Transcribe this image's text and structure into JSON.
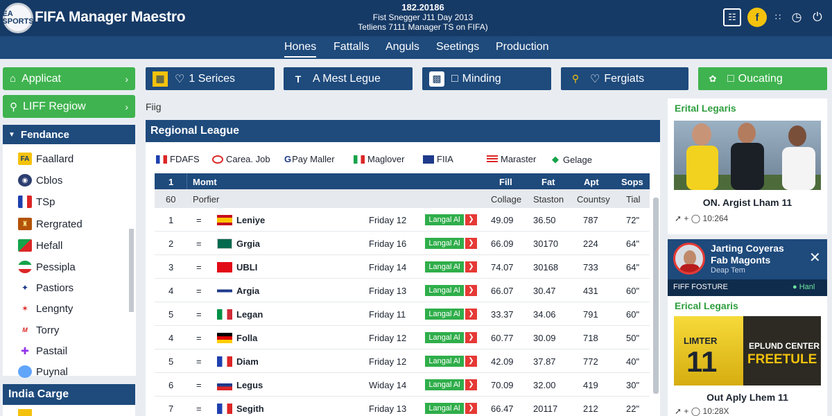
{
  "app": {
    "logo_text": "EA SPORTS",
    "title": "FIFA Manager Maestro"
  },
  "header_info": {
    "line1": "182.20186",
    "line2": "Fist Snegger J11 Day 2013",
    "line3": "Tetliens 7111 Manager TS on FIFA)"
  },
  "nav": {
    "items": [
      "Hones",
      "Fattalls",
      "Anguls",
      "Seetings",
      "Production"
    ]
  },
  "left": {
    "btn1": "Applicat",
    "btn2": "LIFF Regiow",
    "panel_title": "Fendance",
    "items": [
      "Faallard",
      "Cblos",
      "TSp",
      "Rergrated",
      "Hefall",
      "Pessipla",
      "Pastiors",
      "Lengnty",
      "Torry",
      "Pastail",
      "Puynal"
    ],
    "bottom_title": "India Carge"
  },
  "top_buttons": [
    "1 Serices",
    "A Mest Legue",
    "Minding",
    "Fergiats",
    "Oucating"
  ],
  "breadcrumb": "Fiig",
  "league": {
    "title": "Regional League",
    "filters": [
      "FDAFS",
      "Carea. Job",
      "Pay Maller",
      "Maglover",
      "FIIA",
      "Maraster",
      "Gelage"
    ],
    "header": {
      "rank": "1",
      "team": "Momt",
      "c1": "Fill",
      "c2": "Fat",
      "c3": "Apt",
      "c4": "Sops"
    },
    "subheader": {
      "rank": "60",
      "team": "Porfier",
      "c1": "Collage",
      "c2": "Staston",
      "c3": "Countsy",
      "c4": "Tial"
    },
    "badge_label": "Langal Al",
    "rows": [
      {
        "rank": "1",
        "team": "Leniye",
        "date": "Friday 12",
        "v1": "49.09",
        "v2": "36.50",
        "v3": "787",
        "v4": "72\""
      },
      {
        "rank": "2",
        "team": "Grgia",
        "date": "Friday 16",
        "v1": "66.09",
        "v2": "30170",
        "v3": "224",
        "v4": "64\""
      },
      {
        "rank": "3",
        "team": "UBLI",
        "date": "Friday 14",
        "v1": "74.07",
        "v2": "30168",
        "v3": "733",
        "v4": "64\""
      },
      {
        "rank": "4",
        "team": "Argia",
        "date": "Friday 13",
        "v1": "66.07",
        "v2": "30.47",
        "v3": "431",
        "v4": "60\""
      },
      {
        "rank": "5",
        "team": "Legan",
        "date": "Friday 11",
        "v1": "33.37",
        "v2": "34.06",
        "v3": "791",
        "v4": "60\""
      },
      {
        "rank": "4",
        "team": "Folla",
        "date": "Friday 12",
        "v1": "60.77",
        "v2": "30.09",
        "v3": "718",
        "v4": "50\""
      },
      {
        "rank": "5",
        "team": "Diam",
        "date": "Friday 12",
        "v1": "42.09",
        "v2": "37.87",
        "v3": "772",
        "v4": "40\""
      },
      {
        "rank": "6",
        "team": "Legus",
        "date": "Widay 14",
        "v1": "70.09",
        "v2": "32.00",
        "v3": "419",
        "v4": "30\""
      },
      {
        "rank": "7",
        "team": "Segith",
        "date": "Friday 13",
        "v1": "66.47",
        "v2": "20117",
        "v3": "212",
        "v4": "22\""
      }
    ]
  },
  "right": {
    "card1": {
      "title": "Erital Legaris",
      "caption": "ON. Argist Lham 11",
      "meta": "10:264"
    },
    "notif": {
      "line1": "Jarting Coyeras",
      "line2": "Fab Magonts",
      "line3": "Deap Tem",
      "footer": "FIFF FOSTURE",
      "status": "Hanl"
    },
    "card2": {
      "title": "Erical Legaris",
      "caption": "Out Aply Lhem 11",
      "meta": "10:28X",
      "promo1": "EPLUND CENTER",
      "promo2": "FREETULE",
      "shirt_name": "LIMTER",
      "shirt_num": "11"
    }
  },
  "colors": {
    "primary": "#1e4a7c",
    "topbar": "#163a66",
    "accent_green": "#3fb34f",
    "alert_red": "#e53935"
  }
}
